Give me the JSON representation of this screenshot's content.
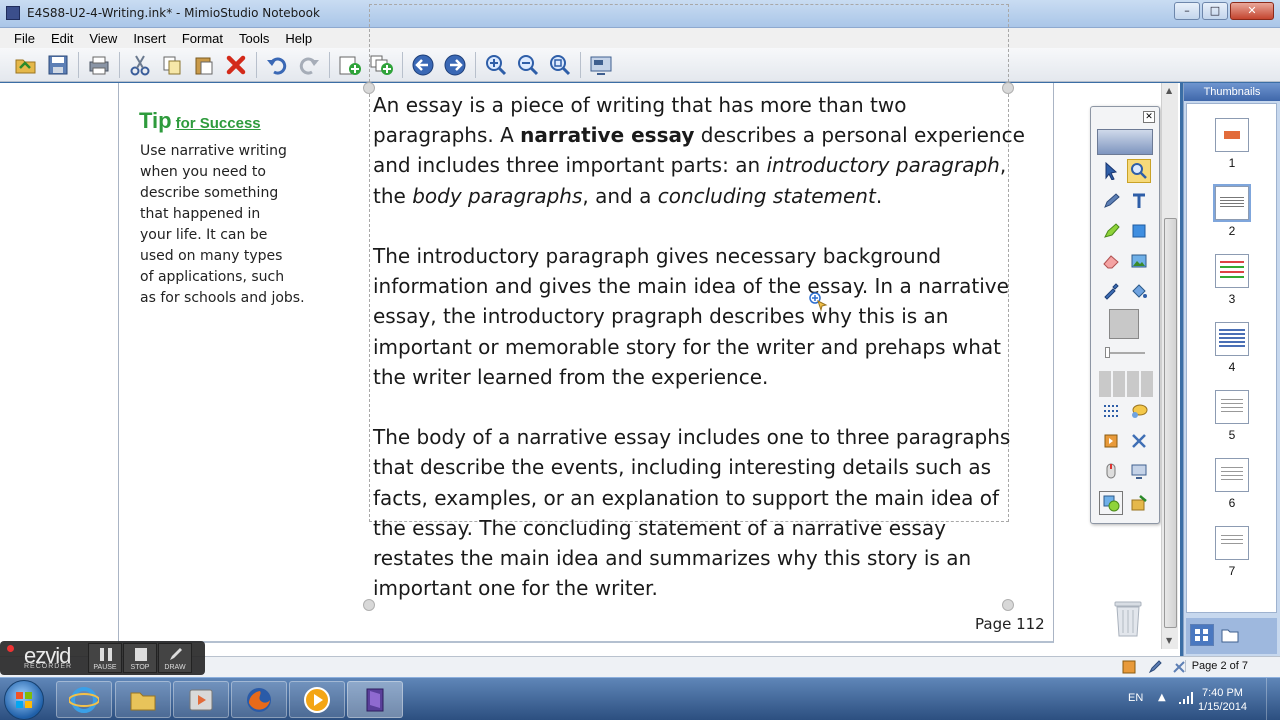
{
  "window": {
    "title": "E4S88-U2-4-Writing.ink* - MimioStudio Notebook",
    "controls": {
      "minimize": "–",
      "maximize": "□",
      "close": "✕"
    }
  },
  "menu": [
    "File",
    "Edit",
    "View",
    "Insert",
    "Format",
    "Tools",
    "Help"
  ],
  "toolbar_icons": [
    "open-icon",
    "save-icon",
    "print-icon",
    "cut-icon",
    "copy-icon",
    "paste-icon",
    "delete-icon",
    "undo-icon",
    "redo-icon",
    "new-page-icon",
    "duplicate-page-icon",
    "previous-page-icon",
    "next-page-icon",
    "zoom-in-icon",
    "zoom-out-icon",
    "zoom-fit-icon",
    "screen-icon"
  ],
  "tip": {
    "title_big": "Tip",
    "title_small": "for Success",
    "lines": [
      "Use narrative writing",
      "when you need to",
      "describe something",
      "that happened in",
      "your life. It can be",
      "used on many types",
      "of applications, such",
      "as for schools and jobs."
    ]
  },
  "essay": {
    "p1": [
      {
        "parts": [
          {
            "t": "An essay is a piece of writing that has more than two"
          }
        ]
      },
      {
        "parts": [
          {
            "t": "paragraphs. A "
          },
          {
            "t": "narrative essay",
            "s": "b"
          },
          {
            "t": " describes a personal experience"
          }
        ]
      },
      {
        "parts": [
          {
            "t": "and includes three important parts: an "
          },
          {
            "t": "introductory paragraph",
            "s": "i"
          },
          {
            "t": ","
          }
        ]
      },
      {
        "parts": [
          {
            "t": "the "
          },
          {
            "t": "body paragraphs",
            "s": "i"
          },
          {
            "t": ", and a "
          },
          {
            "t": "concluding statement",
            "s": "i"
          },
          {
            "t": "."
          }
        ]
      }
    ],
    "p2": [
      "The introductory paragraph gives necessary background",
      "information and gives the main idea of the essay. In a narrative",
      "essay, the introductory pragraph describes why this is an",
      "important or memorable story for the writer and prehaps what",
      "the writer learned from the experience."
    ],
    "p3": [
      "The body of a narrative essay includes one to three paragraphs",
      "that describe the events, including interesting details such as",
      "facts, examples, or an explanation to support the main idea of",
      "the essay. The concluding statement of a narrative essay",
      "restates the main idea and summarizes why this story is an",
      "important one for the writer."
    ]
  },
  "page_label": "Page 112",
  "palette": {
    "close": "✕",
    "active_tool": "zoom"
  },
  "thumbnails": {
    "header": "Thumbnails",
    "items": [
      "1",
      "2",
      "3",
      "4",
      "5",
      "6",
      "7"
    ],
    "selected": "2"
  },
  "status": {
    "page": "Page 2 of 7"
  },
  "ezvid": {
    "logo": "ezvid",
    "sub": "RECORDER",
    "buttons": [
      "PAUSE",
      "STOP",
      "DRAW"
    ]
  },
  "taskbar": {
    "language": "EN",
    "time": "7:40 PM",
    "date": "1/15/2014"
  },
  "colors": {
    "tip_green": "#2e9b3c",
    "title_bar": "#aac6e8",
    "taskbar": "#2c4f80"
  }
}
